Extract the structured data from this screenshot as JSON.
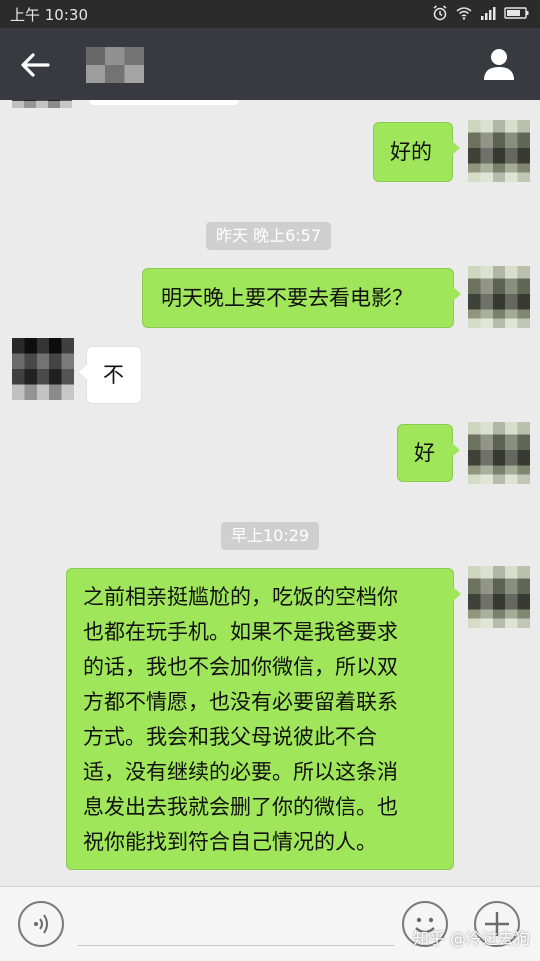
{
  "status_bar": {
    "time": "上午 10:30",
    "icons": [
      "alarm-icon",
      "wifi-icon",
      "signal-icon",
      "battery-icon"
    ]
  },
  "header": {
    "back_icon": "arrow-left-icon",
    "profile_icon": "person-icon"
  },
  "messages": [
    {
      "sender": "me",
      "text": "好的"
    },
    {
      "type": "time",
      "text": "昨天 晚上6:57"
    },
    {
      "sender": "me",
      "text": "明天晚上要不要去看电影？"
    },
    {
      "sender": "other",
      "text": "不"
    },
    {
      "sender": "me",
      "text": "好"
    },
    {
      "type": "time",
      "text": "早上10:29"
    },
    {
      "sender": "me",
      "lines": [
        "之前相亲挺尴尬的，吃饭的空档你",
        "也都在玩手机。如果不是我爸要求",
        "的话，我也不会加你微信，所以双",
        "方都不情愿，也没有必要留着联系",
        "方式。我会和我父母说彼此不合",
        "适，没有继续的必要。所以这条消",
        "息发出去我就会删了你的微信。也",
        "祝你能找到符合自己情况的人。"
      ]
    }
  ],
  "input_bar": {
    "voice_icon": "voice-icon",
    "emoji_icon": "emoji-icon",
    "plus_icon": "plus-icon",
    "watermark": "知乎 @冷过去狗"
  },
  "colors": {
    "header_bg": "#393a3f",
    "my_bubble": "#9fe65a",
    "their_bubble": "#ffffff",
    "chat_bg": "#ebebeb"
  }
}
